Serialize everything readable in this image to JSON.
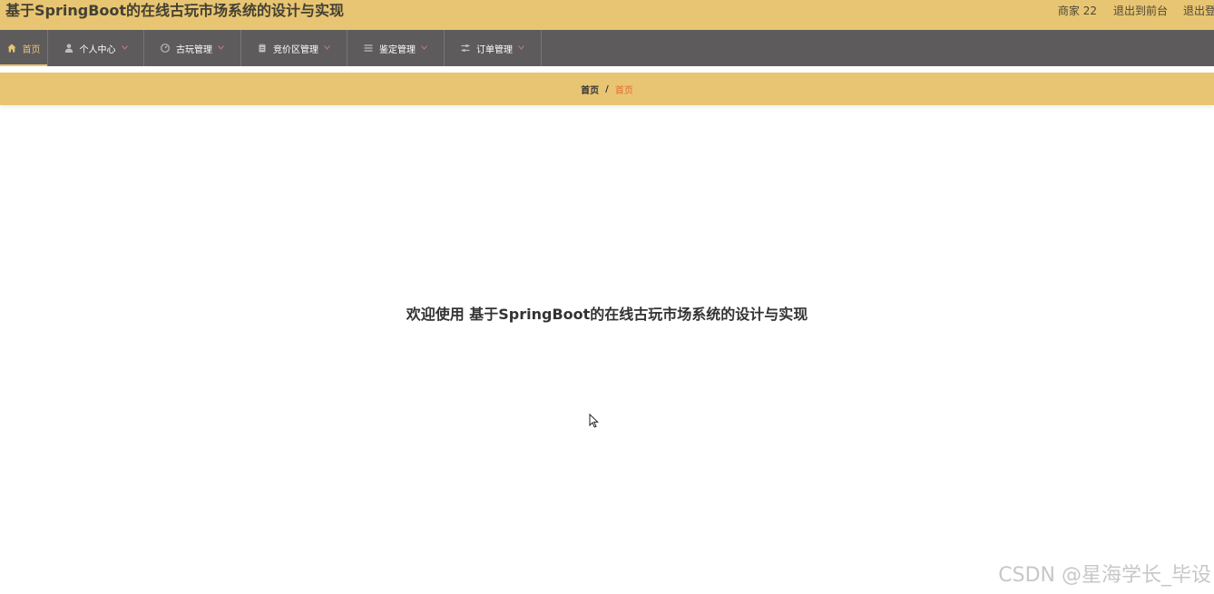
{
  "header": {
    "title": "基于SpringBoot的在线古玩市场系统的设计与实现",
    "user_label": "商家 22",
    "front_link": "退出到前台",
    "logout_link": "退出登录"
  },
  "nav": {
    "items": [
      {
        "label": "首页",
        "icon": "home-icon",
        "active": true
      },
      {
        "label": "个人中心",
        "icon": "user-icon",
        "has_dropdown": true
      },
      {
        "label": "古玩管理",
        "icon": "dashboard-icon",
        "has_dropdown": true
      },
      {
        "label": "竞价区管理",
        "icon": "clipboard-icon",
        "has_dropdown": true
      },
      {
        "label": "鉴定管理",
        "icon": "list-icon",
        "has_dropdown": true
      },
      {
        "label": "订单管理",
        "icon": "sliders-icon",
        "has_dropdown": true
      }
    ]
  },
  "breadcrumb": {
    "home": "首页",
    "separator": "/",
    "current": "首页"
  },
  "main": {
    "welcome": "欢迎使用 基于SpringBoot的在线古玩市场系统的设计与实现"
  },
  "watermark": "CSDN @星海学长_毕设",
  "colors": {
    "header_bg": "#e8c572",
    "nav_bg": "#5d5b5b",
    "active_accent": "#e8c572",
    "breadcrumb_current": "#e86a2d"
  }
}
